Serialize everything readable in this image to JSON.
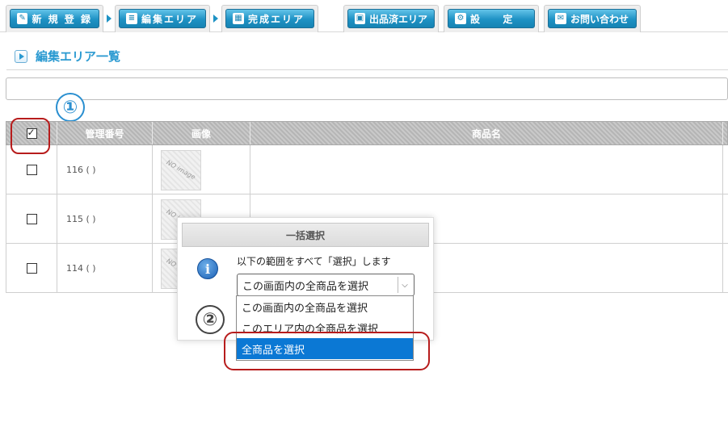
{
  "tabs": [
    {
      "label": "新 規 登 録",
      "icon": "pencil-icon",
      "glyph": "✎"
    },
    {
      "label": "編集エリア",
      "icon": "list-icon",
      "glyph": "≡"
    },
    {
      "label": "完成エリア",
      "icon": "boxes-icon",
      "glyph": "▦"
    },
    {
      "label": "出品済エリア",
      "icon": "box-icon",
      "glyph": "▣"
    },
    {
      "label": "設 　 定",
      "icon": "gear-icon",
      "glyph": "⚙"
    },
    {
      "label": "お問い合わせ",
      "icon": "chat-icon",
      "glyph": "✉"
    }
  ],
  "section": {
    "title": "編集エリア一覧"
  },
  "callouts": {
    "one": "①",
    "two": "②"
  },
  "table": {
    "headers": [
      "管理番号",
      "画像",
      "商品名"
    ],
    "select_all_checked": true,
    "rows": [
      {
        "number": "116 (  )",
        "image": "NO image",
        "name": ""
      },
      {
        "number": "115 (  )",
        "image": "NO image",
        "name": ""
      },
      {
        "number": "114 (  )",
        "image": "NO image",
        "name": ""
      }
    ]
  },
  "dialog": {
    "title": "一括選択",
    "icon": "info-icon",
    "message": "以下の範囲をすべて「選択」します",
    "selected_option": "この画面内の全商品を選択",
    "options": [
      "この画面内の全商品を選択",
      "このエリア内の全商品を選択",
      "全商品を選択"
    ],
    "highlighted_option": "全商品を選択"
  },
  "colors": {
    "accent": "#1e92c4",
    "title_text": "#2b9ad1",
    "callout_one": "#2a8fd0",
    "highlight_ring": "#b71c1c",
    "selected_option_bg": "#0b78d4"
  }
}
